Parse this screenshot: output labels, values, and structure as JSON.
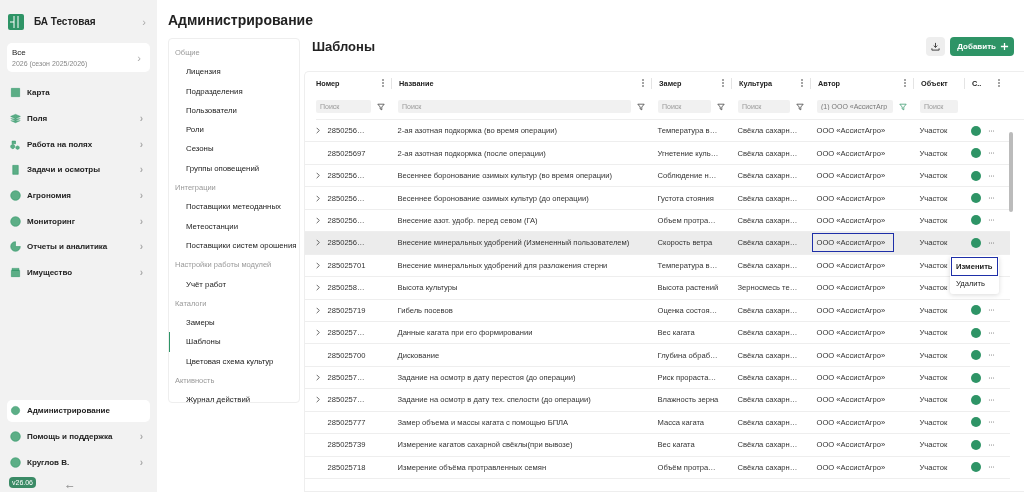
{
  "org": {
    "name": "БА Тестовая",
    "chevron": "›"
  },
  "season": {
    "title": "Все",
    "subtitle": "2026 (сезон 2025/2026)",
    "chevron": "›"
  },
  "nav": [
    {
      "label": "Карта",
      "selected": false
    },
    {
      "label": "Поля",
      "chevron": "›",
      "selected": false
    },
    {
      "label": "Работа на полях",
      "chevron": "›",
      "selected": false
    },
    {
      "label": "Задачи и осмотры",
      "chevron": "›",
      "selected": false
    },
    {
      "label": "Агрономия",
      "chevron": "›",
      "selected": false
    },
    {
      "label": "Мониторинг",
      "chevron": "›",
      "selected": false
    },
    {
      "label": "Отчеты и аналитика",
      "chevron": "›",
      "selected": false
    },
    {
      "label": "Имущество",
      "chevron": "›",
      "selected": false
    }
  ],
  "bottom_nav": [
    {
      "label": "Администрирование",
      "selected": true
    },
    {
      "label": "Помощь и поддержка",
      "chevron": "›",
      "selected": false
    },
    {
      "label": "Круглов В.",
      "chevron": "›",
      "selected": false
    }
  ],
  "version": "v26.06",
  "page_title": "Администрирование",
  "admin_menu": [
    {
      "group": "Общие",
      "items": [
        {
          "label": "Лицензия",
          "selected": false
        },
        {
          "label": "Подразделения",
          "selected": false
        },
        {
          "label": "Пользователи",
          "selected": false
        },
        {
          "label": "Роли",
          "selected": false
        },
        {
          "label": "Сезоны",
          "selected": false
        },
        {
          "label": "Группы оповещений",
          "selected": false
        }
      ]
    },
    {
      "group": "Интеграции",
      "items": [
        {
          "label": "Поставщики метеоданных",
          "selected": false
        },
        {
          "label": "Метеостанции",
          "selected": false
        },
        {
          "label": "Поставщики систем орошения",
          "selected": false
        }
      ]
    },
    {
      "group": "Настройки работы модулей",
      "items": [
        {
          "label": "Учёт работ",
          "selected": false
        }
      ]
    },
    {
      "group": "Каталоги",
      "items": [
        {
          "label": "Замеры",
          "selected": false
        },
        {
          "label": "Шаблоны",
          "selected": true
        },
        {
          "label": "Цветовая схема культур",
          "selected": false
        }
      ]
    },
    {
      "group": "Активность",
      "items": [
        {
          "label": "Журнал действий",
          "selected": false
        }
      ]
    }
  ],
  "section_title": "Шаблоны",
  "add_button": "Добавить",
  "columns": [
    {
      "label": "Номер",
      "menu": true,
      "filter": {
        "placeholder": "Поиск",
        "icon": true
      }
    },
    {
      "label": "Название",
      "menu": true,
      "filter": {
        "placeholder": "Поиск",
        "icon": true
      }
    },
    {
      "label": "Замер",
      "menu": true,
      "filter": {
        "placeholder": "Поиск",
        "icon": true
      }
    },
    {
      "label": "Культура",
      "menu": true,
      "filter": {
        "placeholder": "Поиск",
        "icon": true
      }
    },
    {
      "label": "Автор",
      "menu": true,
      "filter": {
        "value": "(1) ООО «АссистАгр",
        "icon": true,
        "active": true
      }
    },
    {
      "label": "Объект",
      "menu": false,
      "filter": {
        "placeholder": "Поиск",
        "icon": false
      }
    },
    {
      "label": "С..",
      "menu": true
    }
  ],
  "rows": [
    {
      "expandable": true,
      "selected": false,
      "cells": [
        "2850256…",
        "2-ая азотная подкормка (во время операции)",
        "Температура в…",
        "Свёкла сахарн…",
        "ООО «АссистАгро»",
        "Участок"
      ],
      "color": "#2e9466"
    },
    {
      "expandable": false,
      "selected": false,
      "cells": [
        "285025697",
        "2-ая азотная подкормка (после операции)",
        "Угнетение куль…",
        "Свёкла сахарн…",
        "ООО «АссистАгро»",
        "Участок"
      ],
      "color": "#2e9466"
    },
    {
      "expandable": true,
      "selected": false,
      "cells": [
        "2850256…",
        "Весеннее боронование озимых культур (во время операции)",
        "Соблюдение н…",
        "Свёкла сахарн…",
        "ООО «АссистАгро»",
        "Участок"
      ],
      "color": "#2e9466"
    },
    {
      "expandable": true,
      "selected": false,
      "cells": [
        "2850256…",
        "Весеннее боронование озимых культур (до операции)",
        "Густота стояния",
        "Свёкла сахарн…",
        "ООО «АссистАгро»",
        "Участок"
      ],
      "color": "#2e9466"
    },
    {
      "expandable": true,
      "selected": false,
      "cells": [
        "2850256…",
        "Внесение азот. удобр. перед севом (ГА)",
        "Объем протра…",
        "Свёкла сахарн…",
        "ООО «АссистАгро»",
        "Участок"
      ],
      "color": "#2e9466"
    },
    {
      "expandable": true,
      "selected": true,
      "author_focused": true,
      "cells": [
        "2850256…",
        "Внесение минеральных удобрений (Измененный пользователем)",
        "Скорость ветра",
        "Свёкла сахарн…",
        "ООО «АссистАгро»",
        "Участок"
      ],
      "color": "#2e9466"
    },
    {
      "expandable": true,
      "selected": false,
      "cells": [
        "285025701",
        "Внесение минеральных удобрений для разложения стерни",
        "Температура в…",
        "Свёкла сахарн…",
        "ООО «АссистАгро»",
        "Участок"
      ]
    },
    {
      "expandable": true,
      "selected": false,
      "cells": [
        "2850258…",
        "Высота культуры",
        "Высота растений",
        "Зерносмесь те…",
        "ООО «АссистАгро»",
        "Участок"
      ]
    },
    {
      "expandable": true,
      "selected": false,
      "cells": [
        "285025719",
        "Гибель посевов",
        "Оценка состоя…",
        "Свёкла сахарн…",
        "ООО «АссистАгро»",
        "Участок"
      ],
      "color": "#2e9466"
    },
    {
      "expandable": true,
      "selected": false,
      "cells": [
        "2850257…",
        "Данные кагата при его формировании",
        "Вес кагата",
        "Свёкла сахарн…",
        "ООО «АссистАгро»",
        "Участок"
      ],
      "color": "#2e9466"
    },
    {
      "expandable": false,
      "selected": false,
      "cells": [
        "285025700",
        "Дискование",
        "Глубина обраб…",
        "Свёкла сахарн…",
        "ООО «АссистАгро»",
        "Участок"
      ],
      "color": "#2e9466"
    },
    {
      "expandable": true,
      "selected": false,
      "cells": [
        "2850257…",
        "Задание на осмотр в дату перестоя (до операции)",
        "Риск прораста…",
        "Свёкла сахарн…",
        "ООО «АссистАгро»",
        "Участок"
      ],
      "color": "#2e9466"
    },
    {
      "expandable": true,
      "selected": false,
      "cells": [
        "2850257…",
        "Задание на осмотр в дату тех. спелости (до операции)",
        "Влажность зерна",
        "Свёкла сахарн…",
        "ООО «АссистАгро»",
        "Участок"
      ],
      "color": "#2e9466"
    },
    {
      "expandable": false,
      "selected": false,
      "cells": [
        "285025777",
        "Замер объема и массы кагата с помощью БПЛА",
        "Масса кагата",
        "Свёкла сахарн…",
        "ООО «АссистАгро»",
        "Участок"
      ],
      "color": "#2e9466"
    },
    {
      "expandable": false,
      "selected": false,
      "cells": [
        "285025739",
        "Измерение кагатов сахарной свёклы(при вывозе)",
        "Вес кагата",
        "Свёкла сахарн…",
        "ООО «АссистАгро»",
        "Участок"
      ],
      "color": "#2e9466"
    },
    {
      "expandable": false,
      "selected": false,
      "cells": [
        "285025718",
        "Измерение объёма протравленных семян",
        "Объём протра…",
        "Свёкла сахарн…",
        "ООО «АссистАгро»",
        "Участок"
      ],
      "color": "#2e9466"
    }
  ],
  "context_menu": [
    {
      "label": "Изменить",
      "focused": true
    },
    {
      "label": "Удалить",
      "focused": false
    }
  ]
}
